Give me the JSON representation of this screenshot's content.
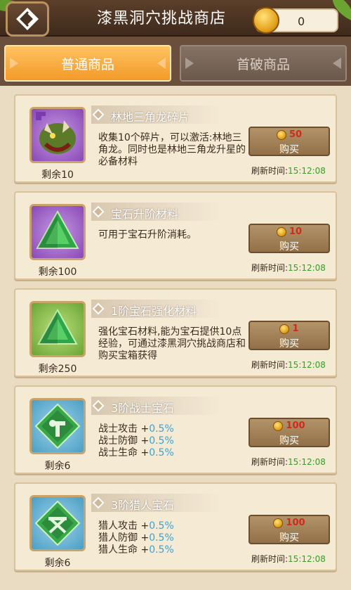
{
  "header": {
    "title": "漆黑洞穴挑战商店",
    "currency_value": "0",
    "back_icon": "back-diamond-icon",
    "currency_icon": "coin-icon"
  },
  "tabs": [
    {
      "label": "普通商品",
      "active": true
    },
    {
      "label": "首破商品",
      "active": false
    }
  ],
  "items": [
    {
      "name": "林地三角龙碎片",
      "remaining": "剩余10",
      "description": "收集10个碎片，可以激活:林地三角龙。同时也是林地三角龙升星的必备材料",
      "price": "50",
      "buy_label": "购买",
      "refresh_label": "刷新时间:",
      "refresh_time": "15:12:08",
      "icon": "triceratops-shard-icon"
    },
    {
      "name": "宝石升阶材料",
      "remaining": "剩余100",
      "description": "可用于宝石升阶消耗。",
      "price": "10",
      "buy_label": "购买",
      "refresh_label": "刷新时间:",
      "refresh_time": "15:12:08",
      "icon": "green-gem-triangle-icon"
    },
    {
      "name": "1阶宝石强化材料",
      "remaining": "剩余250",
      "description": "强化宝石材料,能为宝石提供10点经验，可通过漆黑洞穴挑战商店和购买宝箱获得",
      "price": "1",
      "buy_label": "购买",
      "refresh_label": "刷新时间:",
      "refresh_time": "15:12:08",
      "icon": "green-gem-triangle-icon"
    },
    {
      "name": "3阶战士宝石",
      "remaining": "剩余6",
      "stats": [
        {
          "label": "战士攻击",
          "sign": "+",
          "value": "0.5%"
        },
        {
          "label": "战士防御",
          "sign": "+",
          "value": "0.5%"
        },
        {
          "label": "战士生命",
          "sign": "+",
          "value": "0.5%"
        }
      ],
      "price": "100",
      "buy_label": "购买",
      "refresh_label": "刷新时间:",
      "refresh_time": "15:12:08",
      "icon": "warrior-gem-icon"
    },
    {
      "name": "3阶猎人宝石",
      "remaining": "剩余6",
      "stats": [
        {
          "label": "猎人攻击",
          "sign": "+",
          "value": "0.5%"
        },
        {
          "label": "猎人防御",
          "sign": "+",
          "value": "0.5%"
        },
        {
          "label": "猎人生命",
          "sign": "+",
          "value": "0.5%"
        }
      ],
      "price": "100",
      "buy_label": "购买",
      "refresh_label": "刷新时间:",
      "refresh_time": "15:12:08",
      "icon": "hunter-gem-icon"
    }
  ]
}
